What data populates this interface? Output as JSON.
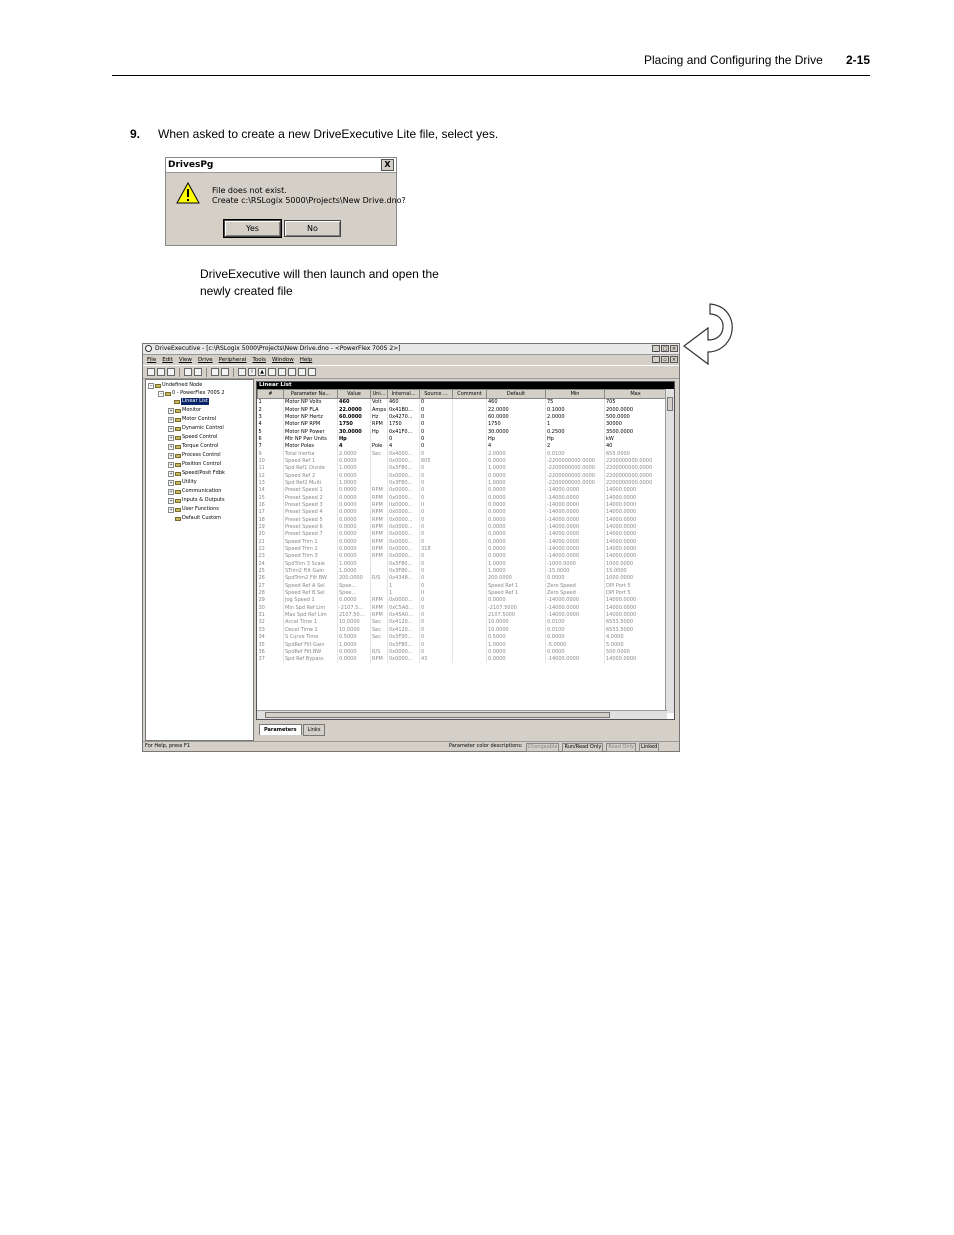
{
  "header": {
    "section_title": "Placing and Configuring the Drive",
    "page_number": "2-15"
  },
  "step": {
    "number": "9.",
    "text": "When asked to create a new DriveExecutive Lite file, select yes."
  },
  "dialog": {
    "title": "DrivesPg",
    "close_label": "X",
    "message_line1": "File does not exist.",
    "message_line2": "Create c:\\RSLogix 5000\\Projects\\New Drive.dno?",
    "yes_label": "Yes",
    "no_label": "No"
  },
  "note": {
    "line1": "DriveExecutive will then launch and open the",
    "line2": "newly created file"
  },
  "app": {
    "title": "DriveExecutive - [c:\\RSLogix 5000\\Projects\\New Drive.dno - <PowerFlex 700S 2>]",
    "menu": [
      "File",
      "Edit",
      "View",
      "Drive",
      "Peripheral",
      "Tools",
      "Window",
      "Help"
    ],
    "tree": {
      "root": "Undefined Node",
      "device": "0 - PowerFlex 700S 2",
      "selected": "Linear List",
      "groups": [
        "Monitor",
        "Motor Control",
        "Dynamic Control",
        "Speed Control",
        "Torque Control",
        "Process Control",
        "Position Control",
        "Speed/Posit Fdbk",
        "Utility",
        "Communication",
        "Inputs & Outputs",
        "User Functions",
        "Default Custom"
      ]
    },
    "grid": {
      "title": "Linear List",
      "columns": [
        "#",
        "Parameter Na...",
        "Value",
        "Uni...",
        "Internal...",
        "Source ...",
        "Comment",
        "Default",
        "Min",
        "Max"
      ],
      "rows": [
        [
          "1",
          "Motor NP Volts",
          "460",
          "Volt",
          "460",
          "0",
          "",
          "460",
          "75",
          "705"
        ],
        [
          "2",
          "Motor NP FLA",
          "22.0000",
          "Amps",
          "0x41B0...",
          "0",
          "",
          "22.0000",
          "0.1000",
          "2000.0000"
        ],
        [
          "3",
          "Motor NP Hertz",
          "60.0000",
          "Hz",
          "0x4270...",
          "0",
          "",
          "60.0000",
          "2.0000",
          "500.0000"
        ],
        [
          "4",
          "Motor NP RPM",
          "1750",
          "RPM",
          "1750",
          "0",
          "",
          "1750",
          "1",
          "30000"
        ],
        [
          "5",
          "Motor NP Power",
          "30.0000",
          "Hp",
          "0x41F0...",
          "0",
          "",
          "30.0000",
          "0.2500",
          "3500.0000"
        ],
        [
          "6",
          "Mtr NP Pwr Units",
          "Hp",
          "",
          "0",
          "0",
          "",
          "Hp",
          "Hp",
          "kW"
        ],
        [
          "7",
          "Motor Poles",
          "4",
          "Pole",
          "4",
          "0",
          "",
          "4",
          "2",
          "40"
        ],
        [
          "9",
          "Total Inertia",
          "2.0000",
          "Sec",
          "0x4000...",
          "0",
          "",
          "2.0000",
          "0.0100",
          "655.0000"
        ],
        [
          "10",
          "Speed Ref 1",
          "0.0000",
          "",
          "0x0000...",
          "605",
          "",
          "0.0000",
          "-2200000000.0000",
          "2200000000.0000"
        ],
        [
          "11",
          "Spd Ref1 Divide",
          "1.0000",
          "",
          "0x3F80...",
          "0",
          "",
          "1.0000",
          "-2200000000.0000",
          "2200000000.0000"
        ],
        [
          "12",
          "Speed Ref 2",
          "0.0000",
          "",
          "0x0000...",
          "0",
          "",
          "0.0000",
          "-2200000000.0000",
          "2200000000.0000"
        ],
        [
          "13",
          "Spd Ref2 Multi",
          "1.0000",
          "",
          "0x3F80...",
          "0",
          "",
          "1.0000",
          "-2200000000.0000",
          "2200000000.0000"
        ],
        [
          "14",
          "Preset Speed 1",
          "0.0000",
          "RPM",
          "0x0000...",
          "0",
          "",
          "0.0000",
          "-14000.0000",
          "14000.0000"
        ],
        [
          "15",
          "Preset Speed 2",
          "0.0000",
          "RPM",
          "0x0000...",
          "0",
          "",
          "0.0000",
          "-14000.0000",
          "14000.0000"
        ],
        [
          "16",
          "Preset Speed 3",
          "0.0000",
          "RPM",
          "0x0000...",
          "0",
          "",
          "0.0000",
          "-14000.0000",
          "14000.0000"
        ],
        [
          "17",
          "Preset Speed 4",
          "0.0000",
          "RPM",
          "0x0000...",
          "0",
          "",
          "0.0000",
          "-14000.0000",
          "14000.0000"
        ],
        [
          "18",
          "Preset Speed 5",
          "0.0000",
          "RPM",
          "0x0000...",
          "0",
          "",
          "0.0000",
          "-14000.0000",
          "14000.0000"
        ],
        [
          "19",
          "Preset Speed 6",
          "0.0000",
          "RPM",
          "0x0000...",
          "0",
          "",
          "0.0000",
          "-14000.0000",
          "14000.0000"
        ],
        [
          "20",
          "Preset Speed 7",
          "0.0000",
          "RPM",
          "0x0000...",
          "0",
          "",
          "0.0000",
          "-14000.0000",
          "14000.0000"
        ],
        [
          "21",
          "Speed Trim 1",
          "0.0000",
          "RPM",
          "0x0000...",
          "0",
          "",
          "0.0000",
          "-14000.0000",
          "14000.0000"
        ],
        [
          "22",
          "Speed Trim 2",
          "0.0000",
          "RPM",
          "0x0000...",
          "318",
          "",
          "0.0000",
          "-14000.0000",
          "14000.0000"
        ],
        [
          "23",
          "Speed Trim 3",
          "0.0000",
          "RPM",
          "0x0000...",
          "0",
          "",
          "0.0000",
          "-14000.0000",
          "14000.0000"
        ],
        [
          "24",
          "SpdTrim 3 Scale",
          "1.0000",
          "",
          "0x3F80...",
          "0",
          "",
          "1.0000",
          "-1000.0000",
          "1000.0000"
        ],
        [
          "25",
          "STrim2 Filt Gain",
          "1.0000",
          "",
          "0x3F80...",
          "0",
          "",
          "1.0000",
          "-15.0000",
          "15.0000"
        ],
        [
          "26",
          "SpdTrim2 Filt BW",
          "200.0000",
          "R/S",
          "0x4348...",
          "0",
          "",
          "200.0000",
          "0.0000",
          "1000.0000"
        ],
        [
          "27",
          "Speed Ref A Sel",
          "Spee...",
          "",
          "1",
          "0",
          "",
          "Speed Ref 1",
          "Zero Speed",
          "DPI Port 5"
        ],
        [
          "28",
          "Speed Ref B Sel",
          "Spee...",
          "",
          "1",
          "0",
          "",
          "Speed Ref 1",
          "Zero Speed",
          "DPI Port 5"
        ],
        [
          "29",
          "Jog Speed 1",
          "0.0000",
          "RPM",
          "0x0000...",
          "0",
          "",
          "0.0000",
          "-14000.0000",
          "14000.0000"
        ],
        [
          "30",
          "Min Spd Ref Lim",
          "-2107.5...",
          "RPM",
          "0xC5A0...",
          "0",
          "",
          "-2107.5000",
          "-14000.0000",
          "14000.0000"
        ],
        [
          "31",
          "Max Spd Ref Lim",
          "2107.50...",
          "RPM",
          "0x45A0...",
          "0",
          "",
          "2107.5000",
          "-14000.0000",
          "14000.0000"
        ],
        [
          "32",
          "Accel Time 1",
          "10.0000",
          "Sec",
          "0x4120...",
          "0",
          "",
          "10.0000",
          "0.0100",
          "6553.5000"
        ],
        [
          "33",
          "Decel Time 1",
          "10.0000",
          "Sec",
          "0x4120...",
          "0",
          "",
          "10.0000",
          "0.0100",
          "6553.5000"
        ],
        [
          "34",
          "S Curve Time",
          "0.5000",
          "Sec",
          "0x3F00...",
          "0",
          "",
          "0.5000",
          "0.0000",
          "4.0000"
        ],
        [
          "35",
          "SpdRef Filt Gain",
          "1.0000",
          "",
          "0x3F80...",
          "0",
          "",
          "1.0000",
          "-5.0000",
          "5.0000"
        ],
        [
          "36",
          "SpdRef Filt BW",
          "0.0000",
          "R/S",
          "0x0000...",
          "0",
          "",
          "0.0000",
          "0.0000",
          "500.0000"
        ],
        [
          "37",
          "Spd Ref Bypass",
          "0.0000",
          "RPM",
          "0x0000...",
          "43",
          "",
          "0.0000",
          "-14000.0000",
          "14000.0000"
        ]
      ],
      "rw_rows": [
        0,
        1,
        2,
        3,
        4,
        5,
        6
      ]
    },
    "tabs": [
      "Parameters",
      "Links"
    ],
    "status": {
      "help": "For Help, press F1",
      "legend_label": "Parameter color descriptions:",
      "legend": [
        "Changeable",
        "Run/Read Only",
        "Read Only",
        "Linked"
      ]
    }
  }
}
